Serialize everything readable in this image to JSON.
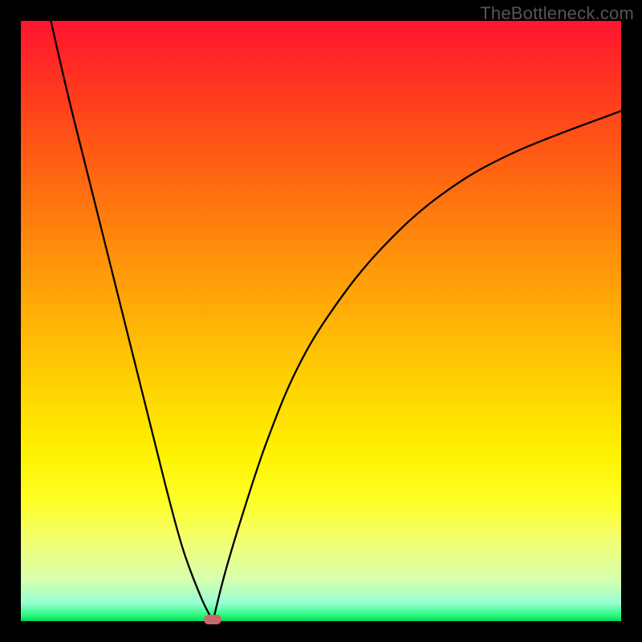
{
  "watermark": "TheBottleneck.com",
  "colors": {
    "page_bg": "#000000",
    "gradient_top": "#ff1430",
    "gradient_mid": "#fff200",
    "gradient_bottom": "#00d85e",
    "curve": "#000000",
    "marker": "#c76a68"
  },
  "chart_data": {
    "type": "line",
    "title": "",
    "xlabel": "",
    "ylabel": "",
    "xlim": [
      0,
      100
    ],
    "ylim": [
      0,
      100
    ],
    "grid": false,
    "legend": false,
    "series": [
      {
        "name": "left-branch",
        "x": [
          5,
          8,
          12,
          16,
          20,
          24,
          27,
          30,
          32
        ],
        "values": [
          100,
          87,
          71,
          55,
          39,
          23,
          12,
          4,
          0
        ]
      },
      {
        "name": "right-branch",
        "x": [
          32,
          34,
          37,
          41,
          46,
          52,
          60,
          70,
          82,
          100
        ],
        "values": [
          0,
          8,
          18,
          30,
          42,
          52,
          62,
          71,
          78,
          85
        ]
      }
    ],
    "annotations": [
      {
        "type": "marker",
        "x": 32,
        "y": 0,
        "shape": "rounded-rect",
        "color": "#c76a68"
      }
    ]
  }
}
